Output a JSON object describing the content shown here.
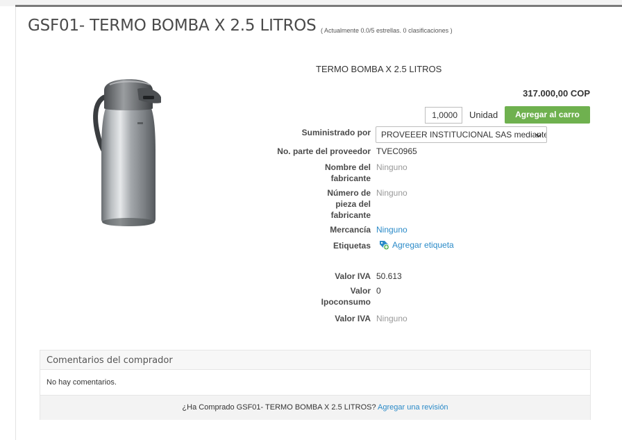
{
  "product": {
    "title": "GSF01- TERMO BOMBA X 2.5 LITROS",
    "rating": "( Actualmente 0.0/5 estrellas. 0 clasificaciones )",
    "description": "TERMO BOMBA X 2.5 LITROS",
    "price": "317.000,00 COP",
    "image_icon": "thermos-pump-image"
  },
  "purchase": {
    "quantity": "1,0000",
    "unit": "Unidad",
    "add_to_cart": "Agregar al carro"
  },
  "details": {
    "supplied_by_label": "Suministrado por",
    "supplied_by_value": "PROVEEER INSTITUCIONAL SAS mediante",
    "supplier_part_label": "No. parte del proveedor",
    "supplier_part_value": "TVEC0965",
    "manufacturer_name_label": "Nombre del fabricante",
    "manufacturer_name_value": "Ninguno",
    "manufacturer_part_label": "Número de pieza del fabricante",
    "manufacturer_part_value": "Ninguno",
    "commodity_label": "Mercancía",
    "commodity_value": "Ninguno",
    "tags_label": "Etiquetas",
    "tags_add": "Agregar etiqueta",
    "iva_label": "Valor IVA",
    "iva_value": "50.613",
    "ipoconsumo_label": "Valor Ipoconsumo",
    "ipoconsumo_value": "0",
    "iva2_label": "Valor IVA",
    "iva2_value": "Ninguno"
  },
  "comments": {
    "title": "Comentarios del comprador",
    "empty": "No hay comentarios.",
    "prompt": "¿Ha Comprado GSF01- TERMO BOMBA X 2.5 LITROS?",
    "review_link": "Agregar una revisión"
  },
  "colors": {
    "accent_green": "#6fb14f",
    "link_blue": "#2a8ac8"
  }
}
